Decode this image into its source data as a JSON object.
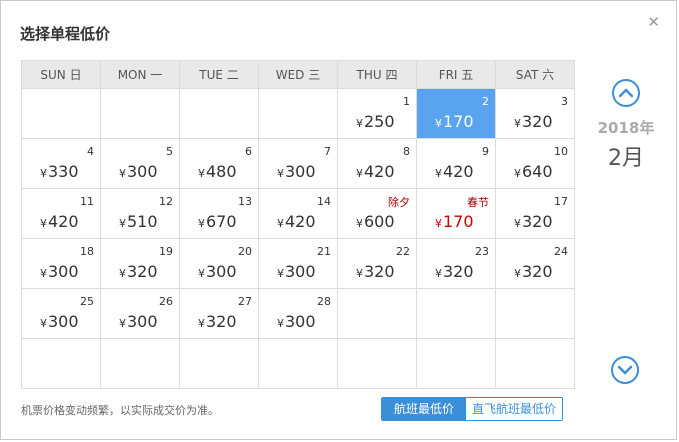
{
  "dialog": {
    "title": "选择单程低价",
    "close_icon": "close-icon"
  },
  "weekdays": [
    "SUN 日",
    "MON 一",
    "TUE 二",
    "WED 三",
    "THU 四",
    "FRI 五",
    "SAT 六"
  ],
  "calendar": {
    "year": "2018年",
    "month": "2月",
    "currency": "¥",
    "rows": [
      [
        null,
        null,
        null,
        null,
        {
          "day": "1",
          "price": "250"
        },
        {
          "day": "2",
          "price": "170",
          "selected": true
        },
        {
          "day": "3",
          "price": "320"
        }
      ],
      [
        {
          "day": "4",
          "price": "330"
        },
        {
          "day": "5",
          "price": "300"
        },
        {
          "day": "6",
          "price": "480"
        },
        {
          "day": "7",
          "price": "300"
        },
        {
          "day": "8",
          "price": "420"
        },
        {
          "day": "9",
          "price": "420"
        },
        {
          "day": "10",
          "price": "640"
        }
      ],
      [
        {
          "day": "11",
          "price": "420"
        },
        {
          "day": "12",
          "price": "510"
        },
        {
          "day": "13",
          "price": "670"
        },
        {
          "day": "14",
          "price": "420"
        },
        {
          "holiday": "除夕",
          "price": "600"
        },
        {
          "holiday": "春节",
          "price": "170",
          "highlight": true
        },
        {
          "day": "17",
          "price": "320"
        }
      ],
      [
        {
          "day": "18",
          "price": "300"
        },
        {
          "day": "19",
          "price": "320"
        },
        {
          "day": "20",
          "price": "300"
        },
        {
          "day": "21",
          "price": "300"
        },
        {
          "day": "22",
          "price": "320"
        },
        {
          "day": "23",
          "price": "320"
        },
        {
          "day": "24",
          "price": "320"
        }
      ],
      [
        {
          "day": "25",
          "price": "300"
        },
        {
          "day": "26",
          "price": "300"
        },
        {
          "day": "27",
          "price": "320"
        },
        {
          "day": "28",
          "price": "300"
        },
        null,
        null,
        null
      ],
      [
        null,
        null,
        null,
        null,
        null,
        null,
        null
      ]
    ]
  },
  "footer": {
    "note": "机票价格变动频繁，以实际成交价为准。",
    "toggle_on": "航班最低价",
    "toggle_off": "直飞航班最低价"
  },
  "colors": {
    "accent": "#3b8fd9",
    "selected_bg": "#5aa3ee",
    "holiday_red": "#c00"
  }
}
